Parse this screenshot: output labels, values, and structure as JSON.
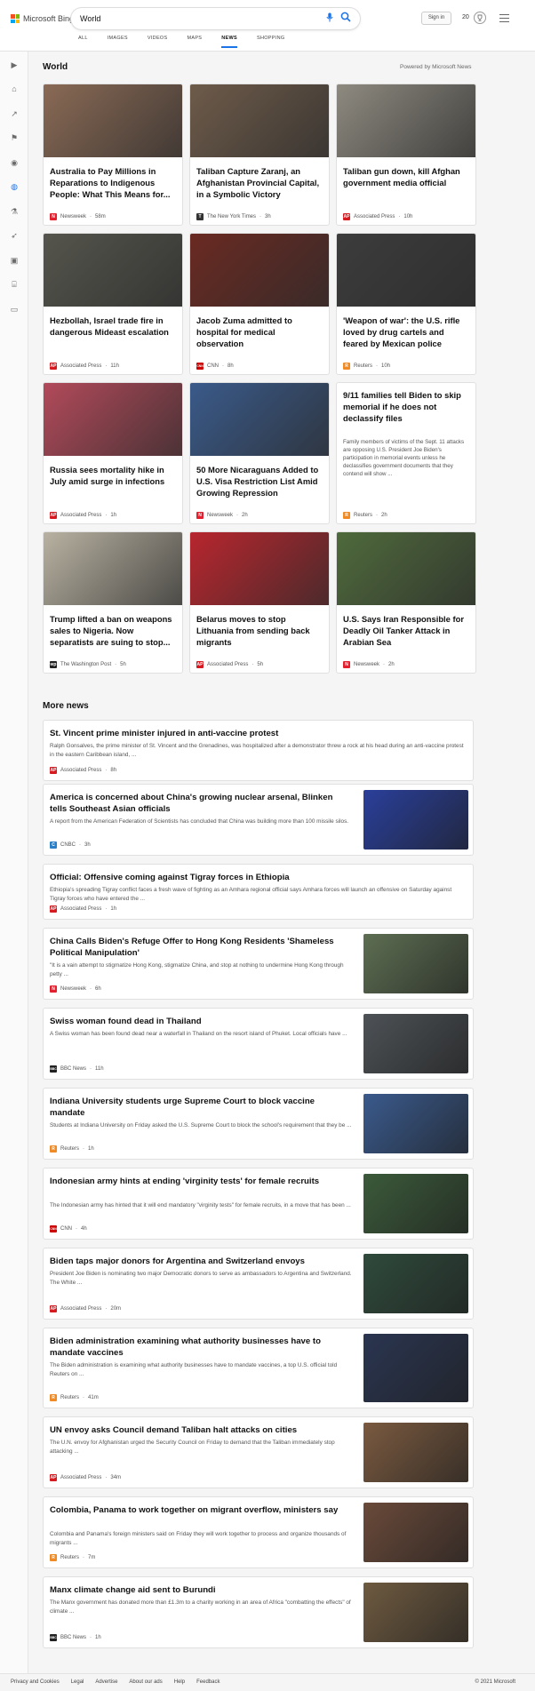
{
  "header": {
    "logo_text": "Microsoft Bing",
    "search_value": "World",
    "tabs": [
      "ALL",
      "IMAGES",
      "VIDEOS",
      "MAPS",
      "NEWS",
      "SHOPPING"
    ],
    "active_tab": "NEWS",
    "signin_label": "Sign in",
    "rewards_points": "20",
    "brand_colors": [
      "#f25022",
      "#7fba00",
      "#00a4ef",
      "#ffb900"
    ],
    "accent": "#1a73e8"
  },
  "sidebar": {
    "icons": [
      "expand-icon",
      "home-icon",
      "trending-icon",
      "flag-icon",
      "pin-icon",
      "globe-icon",
      "microscope-icon",
      "rocket-icon",
      "film-icon",
      "bank-icon",
      "card-icon"
    ],
    "active_icon": "globe-icon"
  },
  "world": {
    "title": "World",
    "powered_by": "Powered by Microsoft News",
    "cards": [
      {
        "title": "Australia to Pay Millions in Reparations to Indigenous People: What This Means for...",
        "source": "Newsweek",
        "time": "58m",
        "logo": "N",
        "logo_color": "#e4202e",
        "image_tone": "#8a6a55",
        "snippet": ""
      },
      {
        "title": "Taliban Capture Zaranj, an Afghanistan Provincial Capital, in a Symbolic Victory",
        "source": "The New York Times",
        "time": "3h",
        "logo": "T",
        "logo_color": "#333333",
        "image_tone": "#6e5b4a",
        "snippet": ""
      },
      {
        "title": "Taliban gun down, kill Afghan government media official",
        "source": "Associated Press",
        "time": "10h",
        "logo": "AP",
        "logo_color": "#d71920",
        "image_tone": "#8e8a80",
        "snippet": ""
      },
      {
        "title": "Hezbollah, Israel trade fire in dangerous Mideast escalation",
        "source": "Associated Press",
        "time": "11h",
        "logo": "AP",
        "logo_color": "#d71920",
        "image_tone": "#55554d",
        "snippet": ""
      },
      {
        "title": "Jacob Zuma admitted to hospital for medical observation",
        "source": "CNN",
        "time": "8h",
        "logo": "CNN",
        "logo_color": "#cc0000",
        "image_tone": "#6a2a22",
        "snippet": ""
      },
      {
        "title": "'Weapon of war': the U.S. rifle loved by drug cartels and feared by Mexican police",
        "source": "Reuters",
        "time": "10h",
        "logo": "R",
        "logo_color": "#f08a24",
        "image_tone": "#3c3c3c",
        "snippet": ""
      },
      {
        "title": "Russia sees mortality hike in July amid surge in infections",
        "source": "Associated Press",
        "time": "1h",
        "logo": "AP",
        "logo_color": "#d71920",
        "image_tone": "#b24a5a",
        "snippet": ""
      },
      {
        "title": "50 More Nicaraguans Added to U.S. Visa Restriction List Amid Growing Repression",
        "source": "Newsweek",
        "time": "2h",
        "logo": "N",
        "logo_color": "#e4202e",
        "image_tone": "#3a5a8a",
        "snippet": ""
      },
      {
        "title": "9/11 families tell Biden to skip memorial if he does not declassify files",
        "source": "Reuters",
        "time": "2h",
        "logo": "R",
        "logo_color": "#f08a24",
        "image_tone": "",
        "snippet": "Family members of victims of the Sept. 11 attacks are opposing U.S. President Joe Biden's participation in memorial events unless he declassifies government documents that they contend will show ..."
      },
      {
        "title": "Trump lifted a ban on weapons sales to Nigeria. Now separatists are suing to stop...",
        "source": "The Washington Post",
        "time": "5h",
        "logo": "wp",
        "logo_color": "#222222",
        "image_tone": "#b9b2a2",
        "snippet": ""
      },
      {
        "title": "Belarus moves to stop Lithuania from sending back migrants",
        "source": "Associated Press",
        "time": "5h",
        "logo": "AP",
        "logo_color": "#d71920",
        "image_tone": "#b8262e",
        "snippet": ""
      },
      {
        "title": "U.S. Says Iran Responsible for Deadly Oil Tanker Attack in Arabian Sea",
        "source": "Newsweek",
        "time": "2h",
        "logo": "N",
        "logo_color": "#e4202e",
        "image_tone": "#4f6a3c",
        "snippet": ""
      }
    ]
  },
  "more_news": {
    "title": "More news",
    "items": [
      {
        "title": "St. Vincent prime minister injured in anti-vaccine protest",
        "snippet": "Ralph Gonsalves, the prime minister of St. Vincent and the Grenadines, was hospitalized after a demonstrator threw a rock at his head during an anti-vaccine protest in the eastern Caribbean island, ...",
        "source": "Associated Press",
        "time": "8h",
        "logo": "AP",
        "logo_color": "#d71920",
        "thumb_tone": ""
      },
      {
        "title": "America is concerned about China's growing nuclear arsenal, Blinken tells Southeast Asian officials",
        "snippet": "A report from the American Federation of Scientists has concluded that China was building more than 100 missile silos.",
        "source": "CNBC",
        "time": "3h",
        "logo": "C",
        "logo_color": "#2a7fc8",
        "thumb_tone": "#2a3f9a"
      },
      {
        "title": "Official: Offensive coming against Tigray forces in Ethiopia",
        "snippet": "Ethiopia's spreading Tigray conflict faces a fresh wave of fighting as an Amhara regional official says Amhara forces will launch an offensive on Saturday against Tigray forces who have entered the ...",
        "source": "Associated Press",
        "time": "1h",
        "logo": "AP",
        "logo_color": "#d71920",
        "thumb_tone": ""
      },
      {
        "title": "China Calls Biden's Refuge Offer to Hong Kong Residents 'Shameless Political Manipulation'",
        "snippet": "\"It is a vain attempt to stigmatize Hong Kong, stigmatize China, and stop at nothing to undermine Hong Kong through petty ...",
        "source": "Newsweek",
        "time": "6h",
        "logo": "N",
        "logo_color": "#e4202e",
        "thumb_tone": "#5d6e52"
      },
      {
        "title": "Swiss woman found dead in Thailand",
        "snippet": "A Swiss woman has been found dead near a waterfall in Thailand on the resort island of Phuket. Local officials have ...",
        "source": "BBC News",
        "time": "11h",
        "logo": "BBC",
        "logo_color": "#222222",
        "thumb_tone": "#4d5256"
      },
      {
        "title": "Indiana University students urge Supreme Court to block vaccine mandate",
        "snippet": "Students at Indiana University on Friday asked the U.S. Supreme Court to block the school's requirement that they be ...",
        "source": "Reuters",
        "time": "1h",
        "logo": "R",
        "logo_color": "#f08a24",
        "thumb_tone": "#3a5a8c"
      },
      {
        "title": "Indonesian army hints at ending 'virginity tests' for female recruits",
        "snippet": "The Indonesian army has hinted that it will end mandatory \"virginity tests\" for female recruits, in a move that has been ...",
        "source": "CNN",
        "time": "4h",
        "logo": "CNN",
        "logo_color": "#cc0000",
        "thumb_tone": "#3b5a3a"
      },
      {
        "title": "Biden taps major donors for Argentina and Switzerland envoys",
        "snippet": "President Joe Biden is nominating two major Democratic donors to serve as ambassadors to Argentina and Switzerland. The White ...",
        "source": "Associated Press",
        "time": "20m",
        "logo": "AP",
        "logo_color": "#d71920",
        "thumb_tone": "#2f4a3c"
      },
      {
        "title": "Biden administration examining what authority businesses have to mandate vaccines",
        "snippet": "The Biden administration is examining what authority businesses have to mandate vaccines, a top U.S. official told Reuters on ...",
        "source": "Reuters",
        "time": "41m",
        "logo": "R",
        "logo_color": "#f08a24",
        "thumb_tone": "#2a3550"
      },
      {
        "title": "UN envoy asks Council demand Taliban halt attacks on cities",
        "snippet": "The U.N. envoy for Afghanistan urged the Security Council on Friday to demand that the Taliban immediately stop attacking ...",
        "source": "Associated Press",
        "time": "34m",
        "logo": "AP",
        "logo_color": "#d71920",
        "thumb_tone": "#7a5a40"
      },
      {
        "title": "Colombia, Panama to work together on migrant overflow, ministers say",
        "snippet": "Colombia and Panama's foreign ministers said on Friday they will work together to process and organize thousands of migrants ...",
        "source": "Reuters",
        "time": "7m",
        "logo": "R",
        "logo_color": "#f08a24",
        "thumb_tone": "#6a4a3a"
      },
      {
        "title": "Manx climate change aid sent to Burundi",
        "snippet": "The Manx government has donated more than £1.3m to a charity working in an area of Africa \"combatting the effects\" of climate ...",
        "source": "BBC News",
        "time": "1h",
        "logo": "BBC",
        "logo_color": "#222222",
        "thumb_tone": "#6e5a40"
      }
    ]
  },
  "footer": {
    "links": [
      "Privacy and Cookies",
      "Legal",
      "Advertise",
      "About our ads",
      "Help",
      "Feedback"
    ],
    "copyright": "© 2021 Microsoft"
  }
}
